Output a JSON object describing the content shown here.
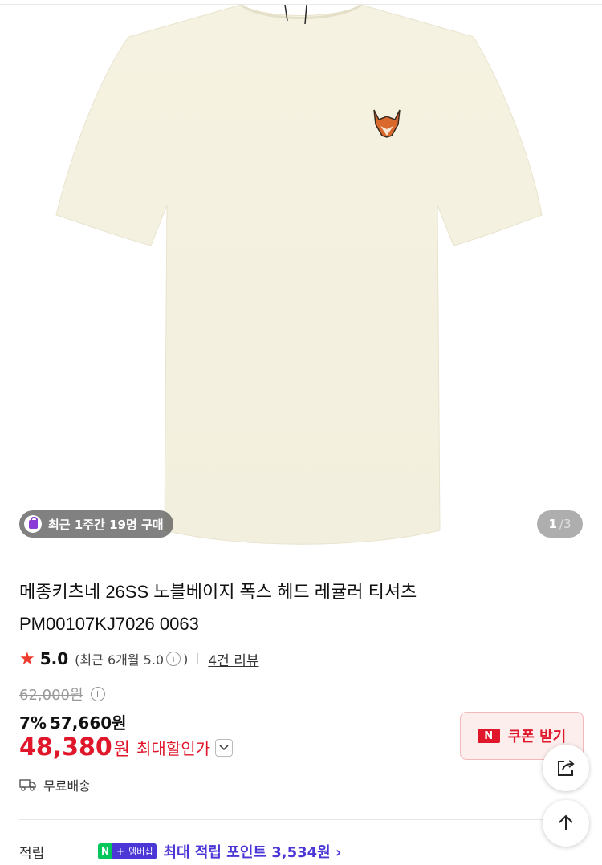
{
  "gallery": {
    "badge_text": "최근 1주간 19명 구매",
    "pager_current": "1",
    "pager_total": "3"
  },
  "product": {
    "title_line1": "메종키츠네 26SS 노블베이지 폭스 헤드 레귤러 티셔츠",
    "title_line2": "PM00107KJ7026 0063",
    "rating_score": "5.0",
    "rating_recent": "(최근 6개월 5.0",
    "rating_recent_close": ")",
    "review_count": "4건 리뷰",
    "original_price": "62,000원",
    "discount_percent": "7%",
    "discount_price": "57,660원",
    "final_price": "48,380",
    "final_currency": "원",
    "final_label": "최대할인가",
    "shipping": "무료배송"
  },
  "coupon": {
    "badge": "N",
    "label": "쿠폰 받기"
  },
  "points": {
    "label": "적립",
    "membership_n": "N",
    "membership_plus": "+",
    "membership_text": "멤버십",
    "text": "최대 적립 포인트 3,534원 ›"
  },
  "icons": [
    "shopping-bag-icon",
    "star-icon",
    "info-icon",
    "chevron-down-icon",
    "truck-icon",
    "share-icon",
    "arrow-up-icon"
  ],
  "colors": {
    "accent_red": "#e0162b",
    "naver_green": "#03c75a",
    "membership_purple": "#4b36d6",
    "star": "#f03c2e"
  }
}
